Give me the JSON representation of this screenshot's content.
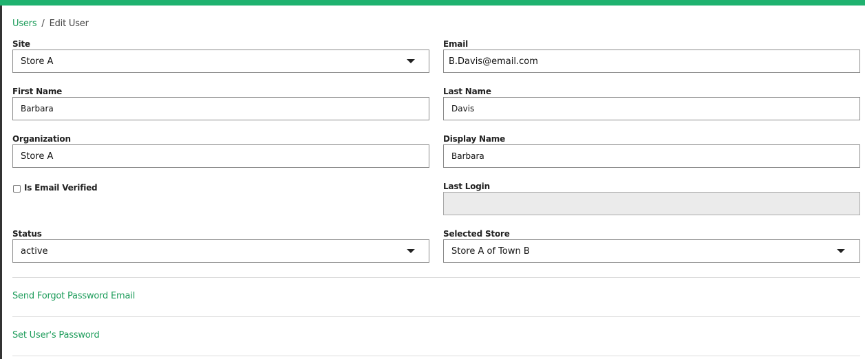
{
  "colors": {
    "accent": "#1fb26f",
    "link": "#1c9c5a"
  },
  "breadcrumb": {
    "parent": "Users",
    "separator": "/",
    "current": "Edit User"
  },
  "form": {
    "site": {
      "label": "Site",
      "value": "Store A",
      "icon": "chevron-down-icon"
    },
    "email": {
      "label": "Email",
      "value": "B.Davis@email.com"
    },
    "first_name": {
      "label": "First Name",
      "value": "Barbara"
    },
    "last_name": {
      "label": "Last Name",
      "value": "Davis"
    },
    "organization": {
      "label": "Organization",
      "value": "Store A"
    },
    "display_name": {
      "label": "Display Name",
      "value": "Barbara"
    },
    "is_email_verified": {
      "label": "Is Email Verified",
      "checked": false
    },
    "last_login": {
      "label": "Last Login",
      "value": ""
    },
    "status": {
      "label": "Status",
      "value": "active",
      "icon": "chevron-down-icon"
    },
    "selected_store": {
      "label": "Selected Store",
      "value": "Store A of Town B",
      "icon": "chevron-down-icon"
    }
  },
  "actions": {
    "forgot_password": "Send Forgot Password Email",
    "set_password": "Set User's Password"
  }
}
